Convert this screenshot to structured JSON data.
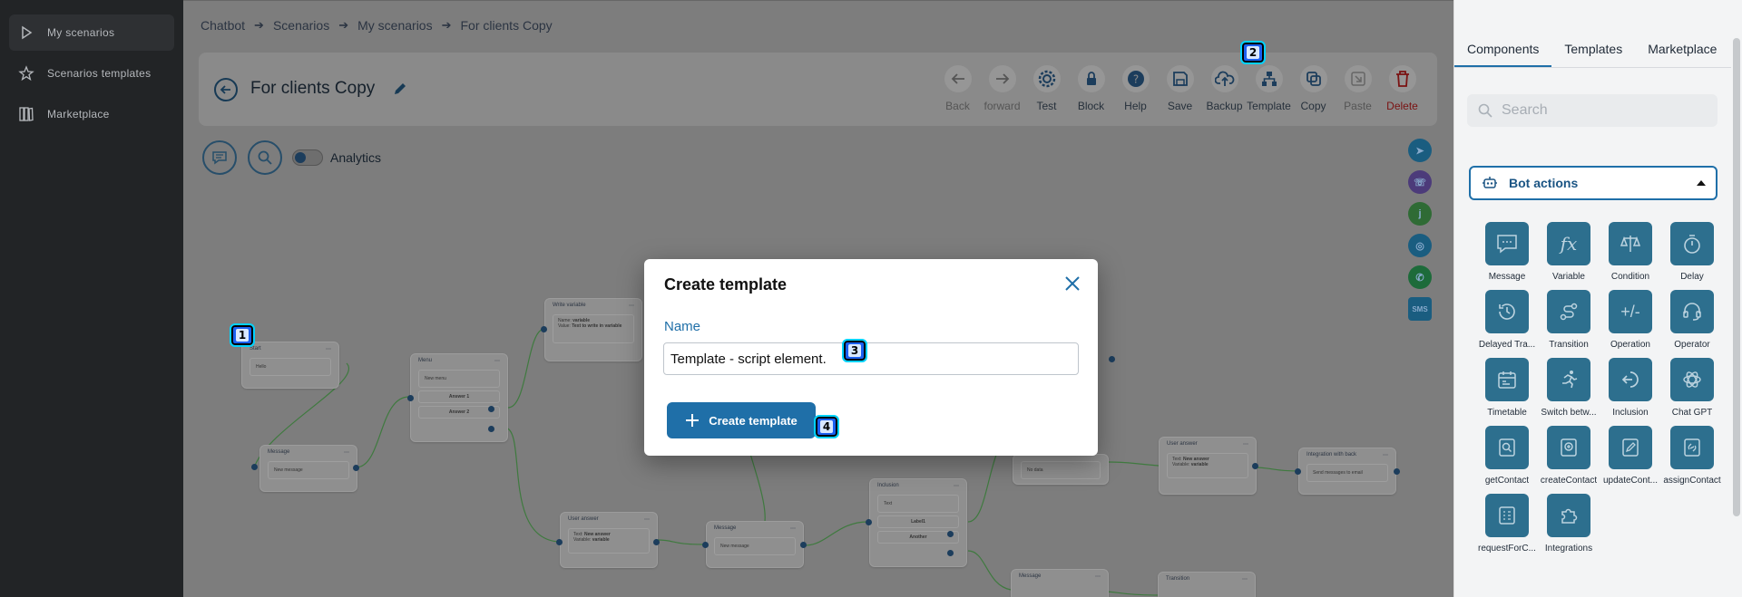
{
  "sidebar": {
    "items": [
      {
        "label": "My scenarios",
        "icon": "play-icon"
      },
      {
        "label": "Scenarios templates",
        "icon": "star-icon"
      },
      {
        "label": "Marketplace",
        "icon": "books-icon"
      }
    ]
  },
  "breadcrumb": [
    "Chatbot",
    "Scenarios",
    "My scenarios",
    "For clients Copy"
  ],
  "scenario_title": "For clients Copy",
  "toolbar": [
    {
      "label": "Back",
      "icon": "arrow-left-icon"
    },
    {
      "label": "forward",
      "icon": "arrow-right-icon"
    },
    {
      "label": "Test",
      "icon": "gear-icon"
    },
    {
      "label": "Block",
      "icon": "lock-icon"
    },
    {
      "label": "Help",
      "icon": "help-icon"
    },
    {
      "label": "Save",
      "icon": "save-icon"
    },
    {
      "label": "Backup",
      "icon": "cloud-upload-icon"
    },
    {
      "label": "Template",
      "icon": "sitemap-icon"
    },
    {
      "label": "Copy",
      "icon": "copy-icon"
    },
    {
      "label": "Paste",
      "icon": "paste-icon"
    },
    {
      "label": "Delete",
      "icon": "trash-icon"
    }
  ],
  "analytics_label": "Analytics",
  "channels": [
    "Telegram",
    "Viber",
    "j",
    "Safari",
    "WhatsApp",
    "SMS"
  ],
  "canvas_nodes": {
    "start": {
      "title": "Start",
      "body": "Hello"
    },
    "message1": {
      "title": "Message",
      "body": "New message"
    },
    "menu": {
      "title": "Menu",
      "body": "New menu",
      "answers": [
        "Answer 1",
        "Answer 2"
      ]
    },
    "write_variable": {
      "title": "Write variable",
      "name_label": "Name:",
      "name_value": "variable",
      "value_label": "Value:",
      "value_value": "Text to write in variable"
    },
    "user_answer1": {
      "title": "User answer",
      "text_label": "Text:",
      "text_value": "New answer",
      "var_label": "Variable:",
      "var_value": "variable"
    },
    "message2": {
      "title": "Message",
      "body": "New message"
    },
    "inclusion": {
      "title": "Inclusion",
      "body": "Text",
      "labels": [
        "Label1",
        "Another"
      ]
    },
    "no_data": {
      "body": "No data"
    },
    "user_answer2": {
      "title": "User answer",
      "text_label": "Text:",
      "text_value": "New answer",
      "var_label": "Variable:",
      "var_value": "variable"
    },
    "integration": {
      "title": "Integration with back",
      "body": "Send messages to email"
    },
    "message3": {
      "title": "Message"
    },
    "transition": {
      "title": "Transition"
    }
  },
  "panel": {
    "tabs": [
      "Components",
      "Templates",
      "Marketplace"
    ],
    "search_placeholder": "Search",
    "section_title": "Bot actions",
    "components": [
      {
        "label": "Message",
        "icon": "message-icon"
      },
      {
        "label": "Variable",
        "icon": "function-icon"
      },
      {
        "label": "Condition",
        "icon": "scales-icon"
      },
      {
        "label": "Delay",
        "icon": "stopwatch-icon"
      },
      {
        "label": "Delayed Tra...",
        "icon": "history-icon"
      },
      {
        "label": "Transition",
        "icon": "route-icon"
      },
      {
        "label": "Operation",
        "icon": "plus-minus-icon"
      },
      {
        "label": "Operator",
        "icon": "headset-icon"
      },
      {
        "label": "Timetable",
        "icon": "calendar-icon"
      },
      {
        "label": "Switch betw...",
        "icon": "runner-icon"
      },
      {
        "label": "Inclusion",
        "icon": "enter-icon"
      },
      {
        "label": "Chat GPT",
        "icon": "openai-icon"
      },
      {
        "label": "getContact",
        "icon": "contact-search-icon"
      },
      {
        "label": "createContact",
        "icon": "contact-add-icon"
      },
      {
        "label": "updateCont...",
        "icon": "contact-edit-icon"
      },
      {
        "label": "assignContact",
        "icon": "contact-assign-icon"
      },
      {
        "label": "requestForC...",
        "icon": "document-icon"
      },
      {
        "label": "Integrations",
        "icon": "puzzle-icon"
      }
    ]
  },
  "modal": {
    "title": "Create template",
    "field_label": "Name",
    "name_value": "Template - script element.",
    "submit_label": "Create template"
  },
  "badges": [
    "1",
    "2",
    "3",
    "4"
  ],
  "colors": {
    "accent": "#1f6fa8",
    "sidebar_bg": "#222426",
    "delete": "#c0392b"
  }
}
